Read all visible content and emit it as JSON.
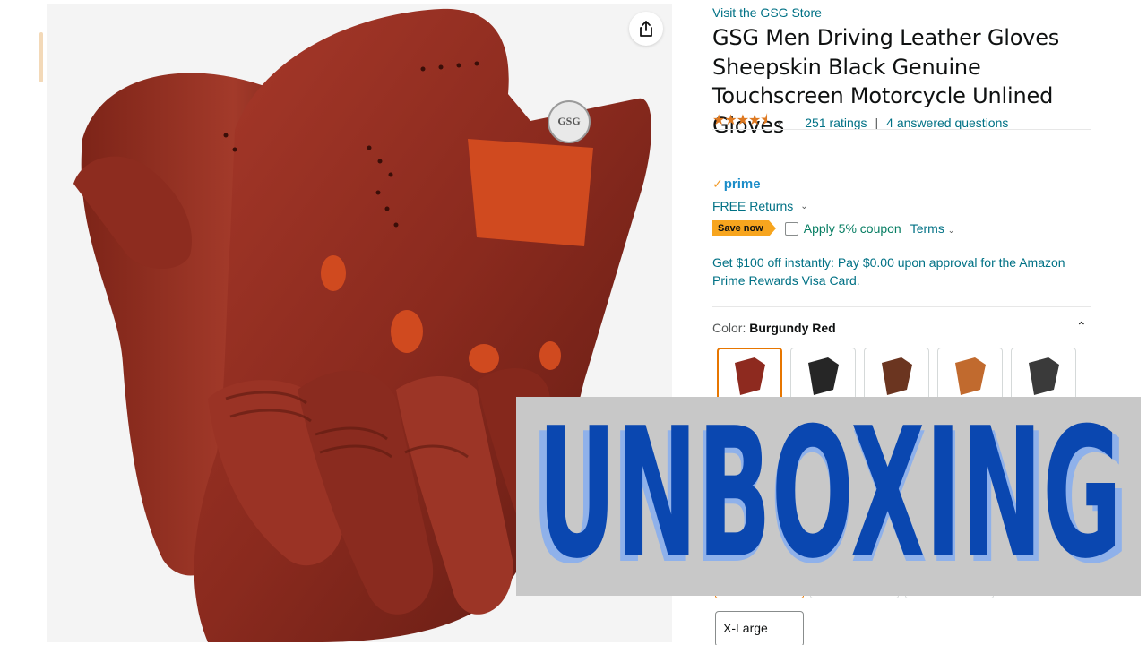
{
  "store": {
    "link": "Visit the GSG Store"
  },
  "product": {
    "title": "GSG Men Driving Leather Gloves Sheepskin Black Genuine Touchscreen Motorcycle Unlined Gloves",
    "stars": "★★★★⯨",
    "rating_count": "251 ratings",
    "separator": "|",
    "questions": "4 answered questions",
    "logo_text": "GSG"
  },
  "shipping": {
    "prime_label": "prime",
    "free_returns": "FREE Returns"
  },
  "coupon": {
    "badge": "Save now",
    "text": "Apply 5% coupon",
    "terms": "Terms"
  },
  "promo": {
    "visa_offer": "Get $100 off instantly: Pay $0.00 upon approval for the Amazon Prime Rewards Visa Card."
  },
  "color": {
    "label": "Color:",
    "selected": "Burgundy Red",
    "swatches": [
      {
        "name": "Burgundy Red",
        "color": "#8e2a1f"
      },
      {
        "name": "Black",
        "color": "#262626"
      },
      {
        "name": "Brown",
        "color": "#6b3520"
      },
      {
        "name": "Tan",
        "color": "#c16a2e"
      },
      {
        "name": "Black Grey",
        "color": "#3a3a3a"
      }
    ]
  },
  "size": {
    "visible_option": "X-Large"
  },
  "banner": {
    "text": "UNBOXING",
    "fill": "#0a47b0",
    "shadow": "#8fb1ea"
  },
  "colors": {
    "link": "#007185",
    "star": "#de7921",
    "accent": "#e77600",
    "leather": "#8e2a1f"
  }
}
